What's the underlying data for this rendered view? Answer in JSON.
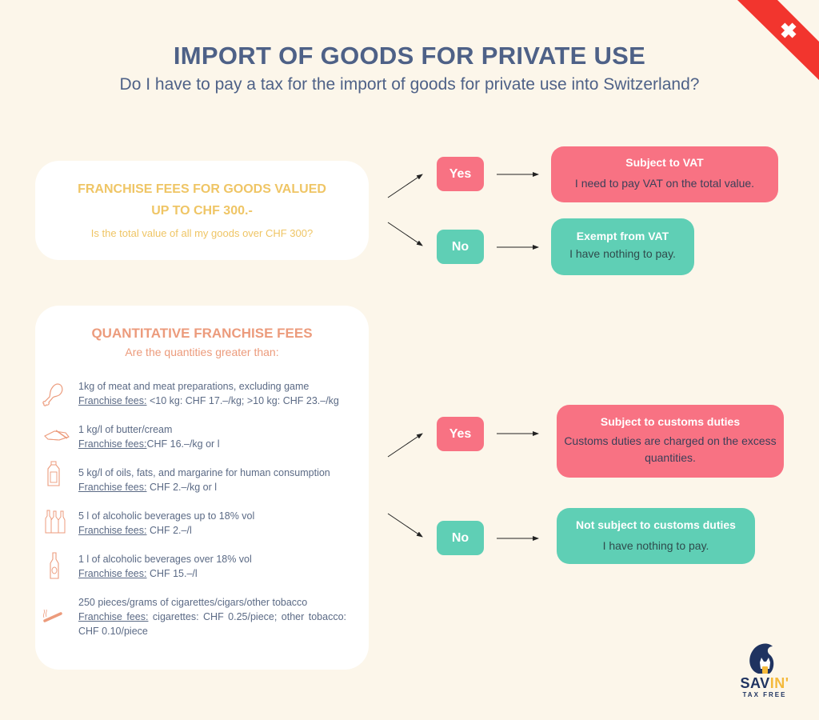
{
  "header": {
    "title": "IMPORT OF GOODS FOR PRIVATE USE",
    "subtitle": "Do I have to pay a tax for the import of goods for private use into Switzerland?"
  },
  "colors": {
    "background": "#fcf6ea",
    "title": "#4e6187",
    "yes_pink": "#f87283",
    "no_green": "#5fcfb5",
    "value_card_text": "#efc565",
    "quantity_card_text": "#ec9b7c",
    "flag_red": "#f2352e"
  },
  "value_section": {
    "title_line1": "FRANCHISE FEES FOR GOODS VALUED",
    "title_line2": "UP TO CHF 300.-",
    "question": "Is the total value of all my goods over CHF 300?",
    "yes_label": "Yes",
    "no_label": "No",
    "yes_result": {
      "title": "Subject to VAT",
      "body": "I need to pay VAT on the total value."
    },
    "no_result": {
      "title": "Exempt from VAT",
      "body": "I have nothing to pay."
    }
  },
  "quantity_section": {
    "title": "QUANTITATIVE FRANCHISE FEES",
    "subtitle": "Are the quantities greater than:",
    "fee_label": "Franchise fees:",
    "items": [
      {
        "icon": "meat-drumstick-icon",
        "description": "1kg of meat and meat preparations, excluding game",
        "fees": " <10 kg: CHF 17.–/kg; >10 kg: CHF 23.–/kg"
      },
      {
        "icon": "butter-icon",
        "description": "1 kg/l of butter/cream",
        "fees": "CHF 16.–/kg or l"
      },
      {
        "icon": "oil-bottle-icon",
        "description": "5 kg/l of oils, fats, and margarine for human consumption",
        "fees": " CHF 2.–/kg or l"
      },
      {
        "icon": "wine-bottles-icon",
        "description": "5 l of alcoholic beverages up to 18% vol",
        "fees": " CHF 2.–/l"
      },
      {
        "icon": "liquor-bottle-icon",
        "description": "1 l of alcoholic beverages over 18% vol",
        "fees": " CHF 15.–/l"
      },
      {
        "icon": "cigarette-icon",
        "description": "250 pieces/grams of cigarettes/cigars/other tobacco",
        "fees": " cigarettes: CHF 0.25/piece; other tobacco: CHF 0.10/piece"
      }
    ],
    "yes_label": "Yes",
    "no_label": "No",
    "yes_result": {
      "title": "Subject to customs duties",
      "body": "Customs duties are charged on the excess quantities."
    },
    "no_result": {
      "title": "Not subject to customs duties",
      "body": "I have nothing to pay."
    }
  },
  "logo": {
    "name_main": "SAV",
    "name_accent": "IN'",
    "tagline": "TAX FREE"
  }
}
